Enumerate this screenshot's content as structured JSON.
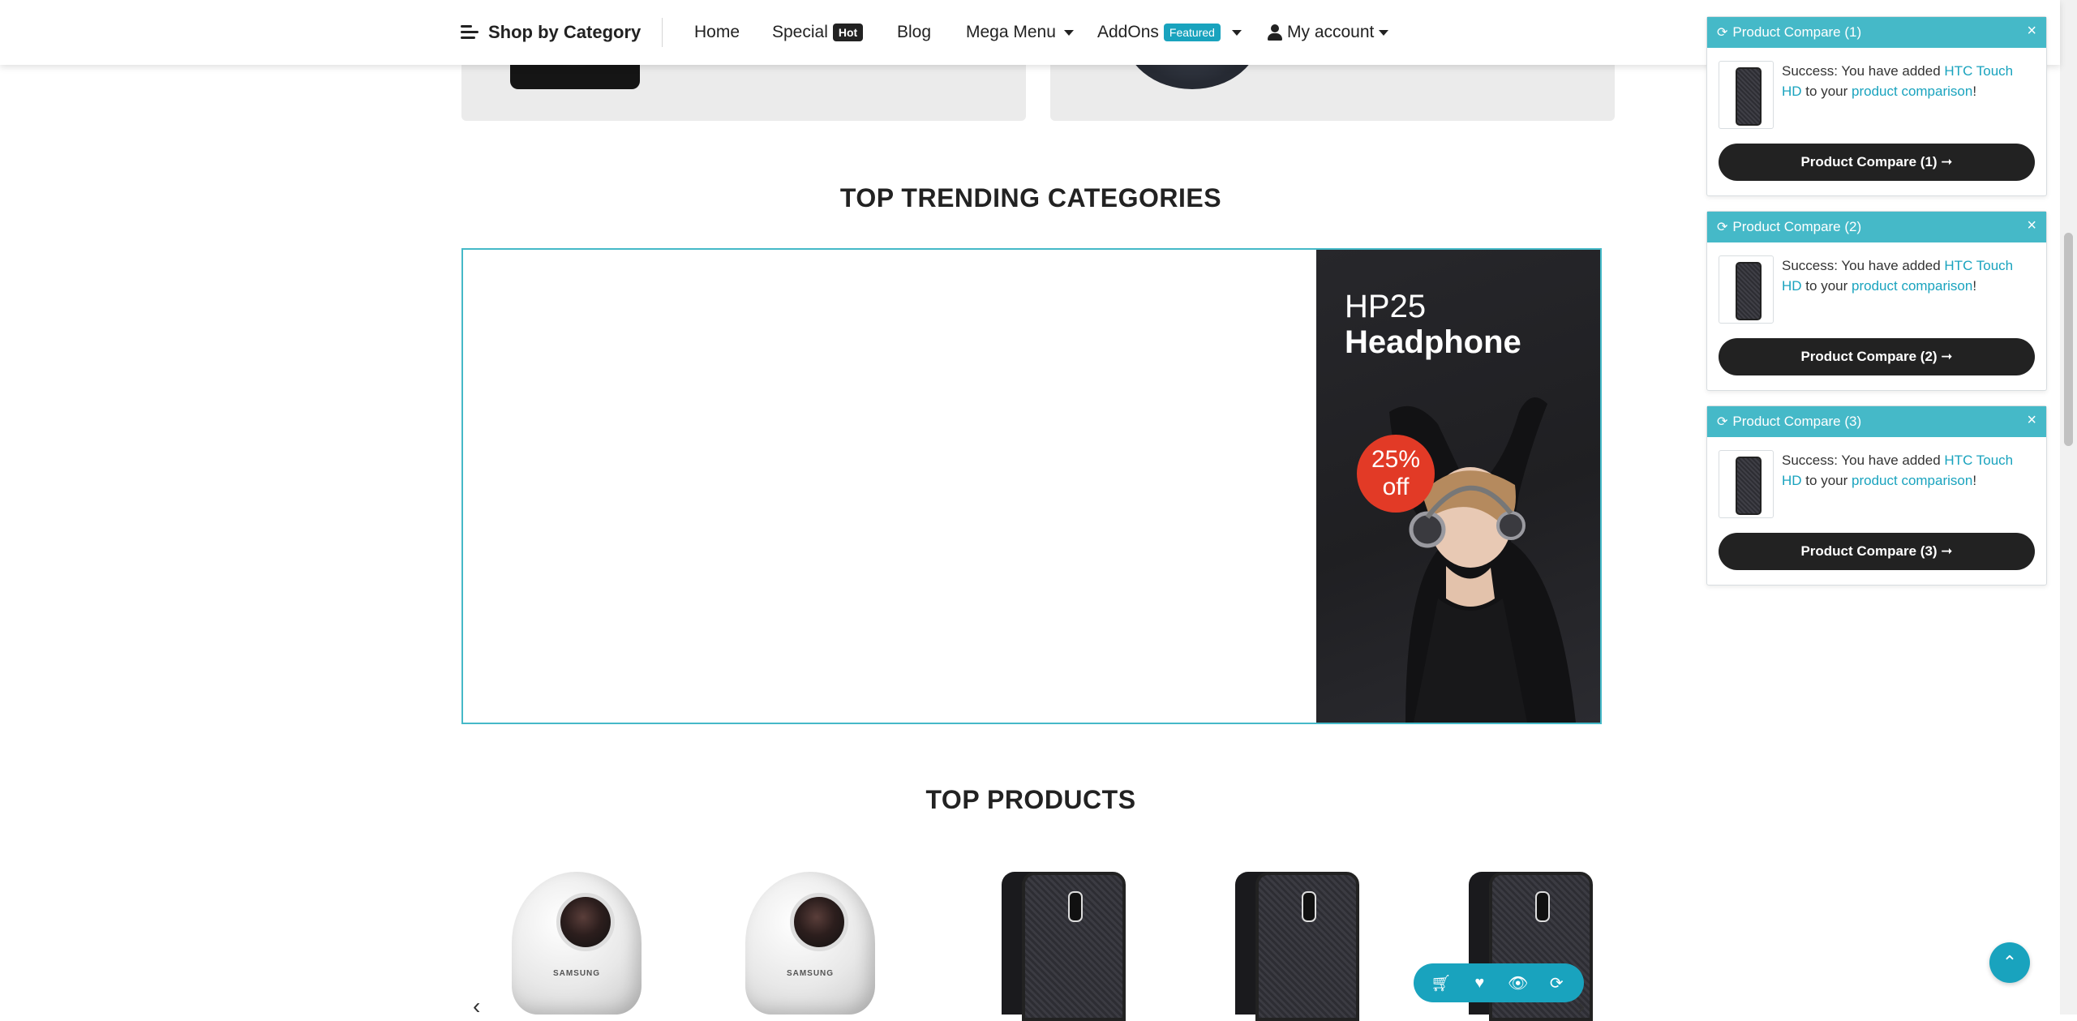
{
  "navbar": {
    "shop_by_category": "Shop by Category",
    "items": [
      {
        "label": "Home"
      },
      {
        "label": "Special",
        "badge": "Hot"
      },
      {
        "label": "Blog"
      },
      {
        "label": "Mega Menu"
      },
      {
        "label": "AddOns",
        "badge": "Featured"
      },
      {
        "label": "My account"
      }
    ]
  },
  "sections": {
    "trending_title": "TOP TRENDING CATEGORIES",
    "products_title": "TOP PRODUCTS"
  },
  "promo": {
    "subtitle": "HP25",
    "title": "Headphone",
    "discount_value": "25%",
    "discount_unit": "off"
  },
  "products": [
    {
      "type": "camera",
      "brand_text": "SAMSUNG"
    },
    {
      "type": "camera",
      "brand_text": "SAMSUNG"
    },
    {
      "type": "phone"
    },
    {
      "type": "phone"
    },
    {
      "type": "phone"
    }
  ],
  "product_actions": [
    "cart-icon",
    "heart-icon",
    "eye-icon",
    "sync-icon"
  ],
  "toasts": [
    {
      "title": "Product Compare (1)",
      "msg_prefix": "Success: You have added",
      "product_link": "HTC Touch HD",
      "msg_middle": "to your",
      "compare_link": "product comparison",
      "msg_suffix": "!",
      "button": "Product Compare (1) ➞"
    },
    {
      "title": "Product Compare (2)",
      "msg_prefix": "Success: You have added",
      "product_link": "HTC Touch HD",
      "msg_middle": "to your",
      "compare_link": "product comparison",
      "msg_suffix": "!",
      "button": "Product Compare (2) ➞"
    },
    {
      "title": "Product Compare (3)",
      "msg_prefix": "Success: You have added",
      "product_link": "HTC Touch HD",
      "msg_middle": "to your",
      "compare_link": "product comparison",
      "msg_suffix": "!",
      "button": "Product Compare (3) ➞"
    }
  ],
  "colors": {
    "accent": "#19a3be",
    "toast_header": "#45b9c8",
    "dark_button": "#222222",
    "discount": "#e23a26"
  }
}
